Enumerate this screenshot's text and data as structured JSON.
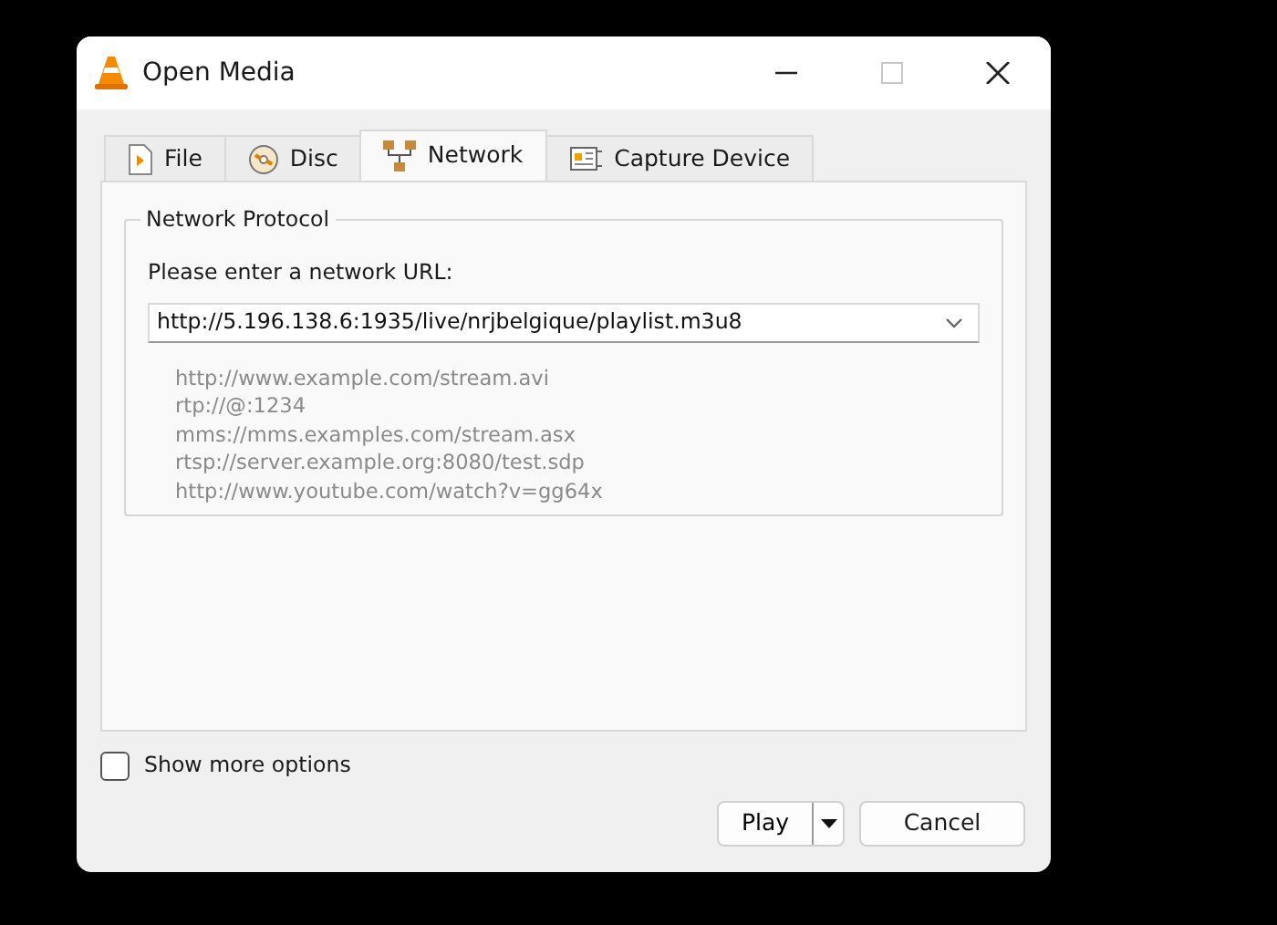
{
  "window": {
    "title": "Open Media"
  },
  "title_buttons": [
    {
      "kind": "minimize",
      "disabled": false
    },
    {
      "kind": "maximize",
      "disabled": true
    },
    {
      "kind": "close",
      "disabled": false
    }
  ],
  "tabs": [
    {
      "label": "File",
      "kind": "file",
      "selected": false
    },
    {
      "label": "Disc",
      "kind": "disc",
      "selected": false
    },
    {
      "label": "Network",
      "kind": "network",
      "selected": true
    },
    {
      "label": "Capture Device",
      "kind": "capture",
      "selected": false
    }
  ],
  "group": {
    "title": "Network Protocol",
    "prompt": "Please enter a network URL:",
    "url": "http://5.196.138.6:1935/live/nrjbelgique/playlist.m3u8",
    "examples": [
      "http://www.example.com/stream.avi",
      "rtp://@:1234",
      "mms://mms.examples.com/stream.asx",
      "rtsp://server.example.org:8080/test.sdp",
      "http://www.youtube.com/watch?v=gg64x"
    ]
  },
  "show_more_options": {
    "label": "Show more options",
    "checked": false
  },
  "buttons": [
    {
      "label": "Play",
      "kind": "split"
    },
    {
      "label": "Cancel",
      "kind": "plain"
    }
  ]
}
